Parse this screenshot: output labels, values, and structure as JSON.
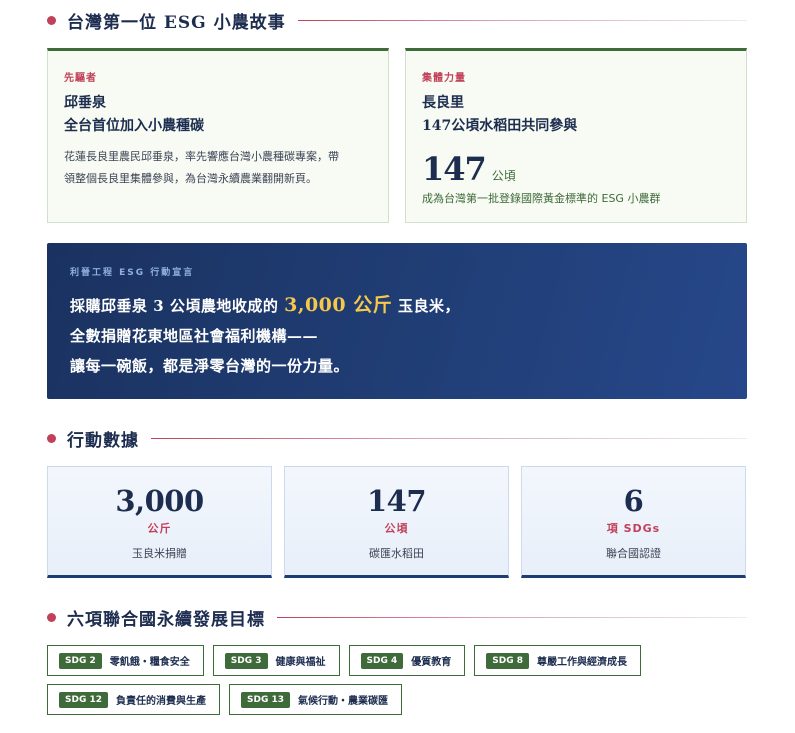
{
  "section1": {
    "title": "台灣第一位 ESG 小農故事"
  },
  "pioneer": {
    "kicker": "先驅者",
    "name_line1": "邱垂泉",
    "name_line2": "全台首位加入小農種碳",
    "body_line1": "花蓮長良里農民邱垂泉，率先響應台灣小農種碳專案，帶",
    "body_line2": "領整個長良里集體參與，為台灣永續農業翻開新頁。"
  },
  "collective": {
    "kicker": "集體力量",
    "name_line1": "長良里",
    "name_line2": "147公頃水稻田共同參與",
    "big_number": "147",
    "big_unit": "公頃",
    "note": "成為台灣第一批登錄國際黃金標準的 ESG 小農群"
  },
  "banner": {
    "kicker": "利晉工程 ESG 行動宣言",
    "line1_pre": "採購邱垂泉 3 公頃農地收成的",
    "line1_highlight": "3,000 公斤",
    "line1_post": "玉良米，",
    "line2": "全數捐贈花東地區社會福利機構——",
    "line3": "讓每一碗飯，都是淨零台灣的一份力量。",
    "highlight_color": "#f5c84c"
  },
  "section2": {
    "title": "行動數據"
  },
  "stats": [
    {
      "number": "3,000",
      "unit": "公斤",
      "label": "玉良米捐贈"
    },
    {
      "number": "147",
      "unit": "公頃",
      "label": "碳匯水稻田"
    },
    {
      "number": "6",
      "unit": "項 SDGs",
      "label": "聯合國認證"
    }
  ],
  "section3": {
    "title": "六項聯合國永續發展目標"
  },
  "sdgs": [
    {
      "badge": "SDG 2",
      "text": "零飢餓・糧食安全"
    },
    {
      "badge": "SDG 3",
      "text": "健康與福祉"
    },
    {
      "badge": "SDG 4",
      "text": "優質教育"
    },
    {
      "badge": "SDG 8",
      "text": "尊嚴工作與經濟成長"
    },
    {
      "badge": "SDG 12",
      "text": "負責任的消費與生產"
    },
    {
      "badge": "SDG 13",
      "text": "氣候行動・農業碳匯"
    }
  ],
  "colors": {
    "accent": "#c2405a",
    "navy": "#1d2d4f",
    "green": "#3f6a3a"
  }
}
